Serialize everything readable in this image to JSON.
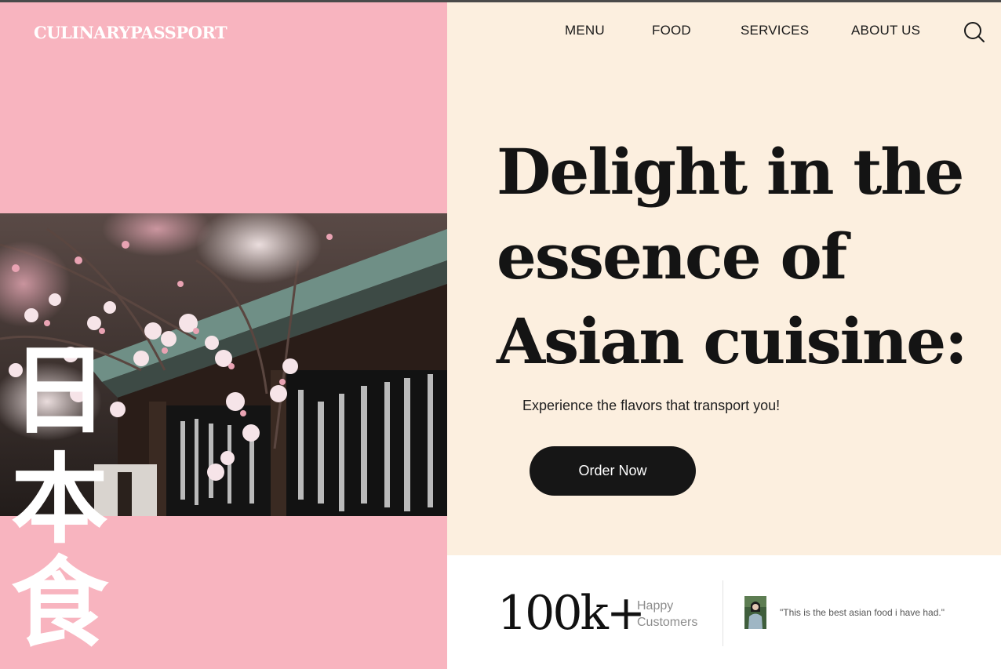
{
  "brand": {
    "logo": "CULINARYPASSPORT"
  },
  "nav": {
    "items": [
      "MENU",
      "FOOD",
      "SERVICES",
      "ABOUT US"
    ],
    "search_icon": "search-icon"
  },
  "hero": {
    "headline": "Delight in the essence of Asian cuisine:",
    "subtitle": "Experience the flavors that transport you!",
    "cta_label": "Order Now",
    "kanji": [
      "日",
      "本",
      "食"
    ]
  },
  "stats": {
    "number": "100k+",
    "label_line1": "Happy",
    "label_line2": "Customers",
    "quote": "\"This is the best asian food i have had.\""
  },
  "colors": {
    "left_panel": "#f8b4bf",
    "right_panel": "#fcefdf",
    "button": "#161616",
    "text_dark": "#141414"
  }
}
